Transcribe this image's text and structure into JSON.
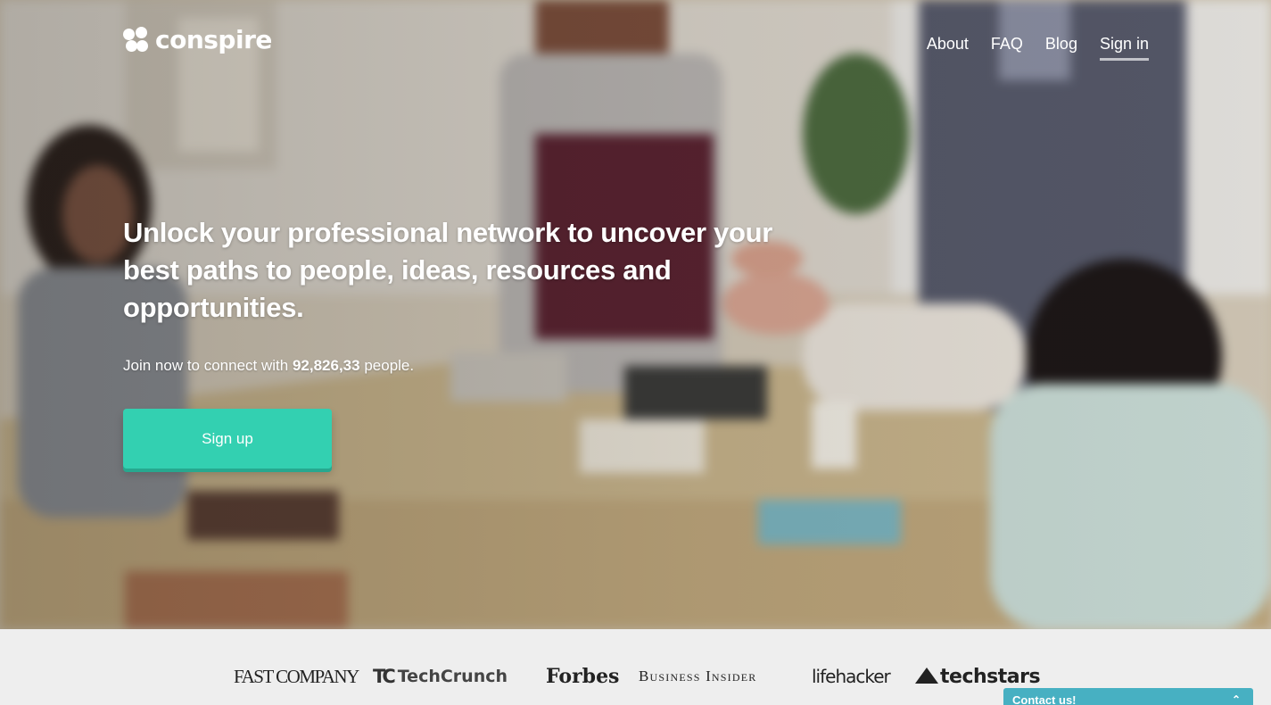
{
  "brand": {
    "name": "conspire"
  },
  "nav": {
    "items": [
      "About",
      "FAQ",
      "Blog",
      "Sign in"
    ],
    "active": "Sign in"
  },
  "hero": {
    "headline": "Unlock your professional network to uncover your best paths to people, ideas, resources and opportunities.",
    "join_prefix": "Join now to connect with",
    "people_count": "92,826,33",
    "join_suffix": "people.",
    "signup_label": "Sign up"
  },
  "press": {
    "logos": [
      "FAST COMPANY",
      "TechCrunch",
      "Forbes",
      "Business Insider",
      "lifehacker",
      "techstars"
    ]
  },
  "contact": {
    "label": "Contact us!",
    "chevron": "chevron-up-icon"
  },
  "colors": {
    "accent": "#33d0b1",
    "contact": "#47b0c2",
    "press_bg": "#eeeeee"
  }
}
